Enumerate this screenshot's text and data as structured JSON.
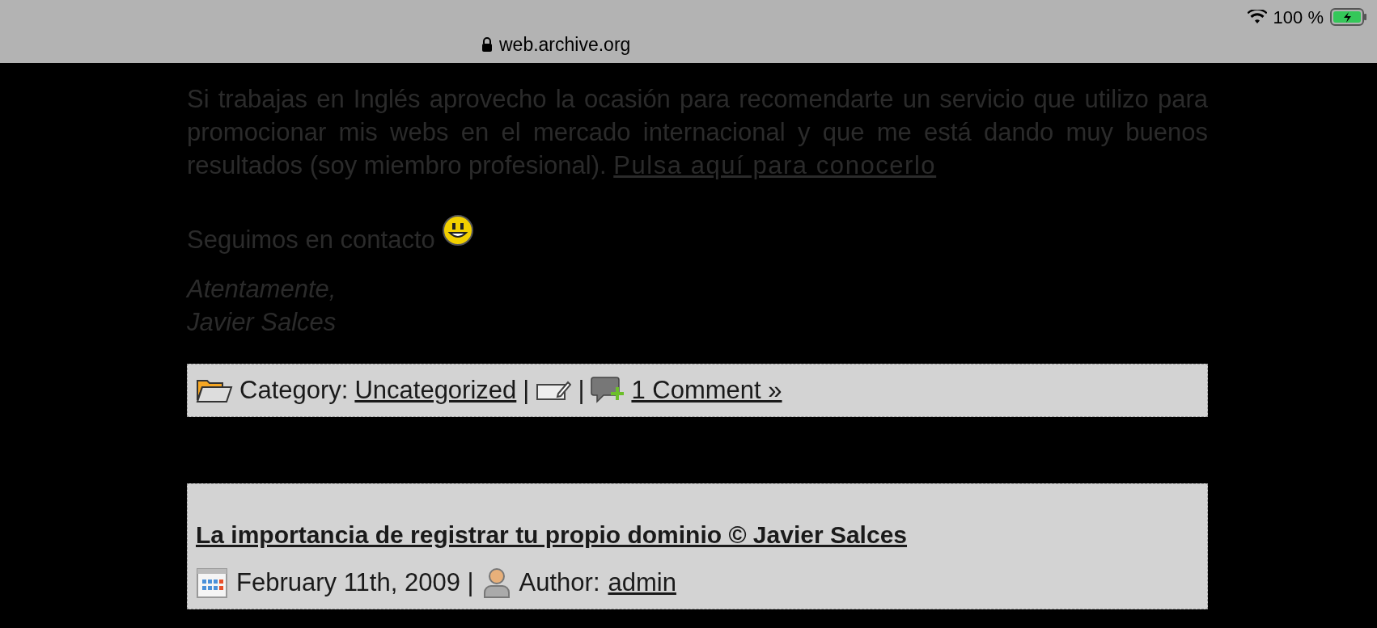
{
  "status_bar": {
    "url": "web.archive.org",
    "battery": "100 %"
  },
  "post_body": {
    "paragraph": "Si trabajas en Inglés aprovecho la ocasión para recomendarte un servicio que utilizo para promocionar mis webs en el mercado internacional y que me está dando muy buenos resultados (soy miembro profesional).",
    "link": "Pulsa aquí para conocerlo",
    "closing": "Seguimos en contacto",
    "signoff": [
      "Atentamente,",
      "Javier Salces"
    ]
  },
  "post_meta": {
    "category_label": "Category:",
    "category": "Uncategorized",
    "separator": "|",
    "comments": "1 Comment »"
  },
  "next_post": {
    "title": "La importancia de registrar tu propio dominio © Javier Salces",
    "date": "February 11th, 2009 |",
    "author_label": "Author:",
    "author": "admin"
  }
}
